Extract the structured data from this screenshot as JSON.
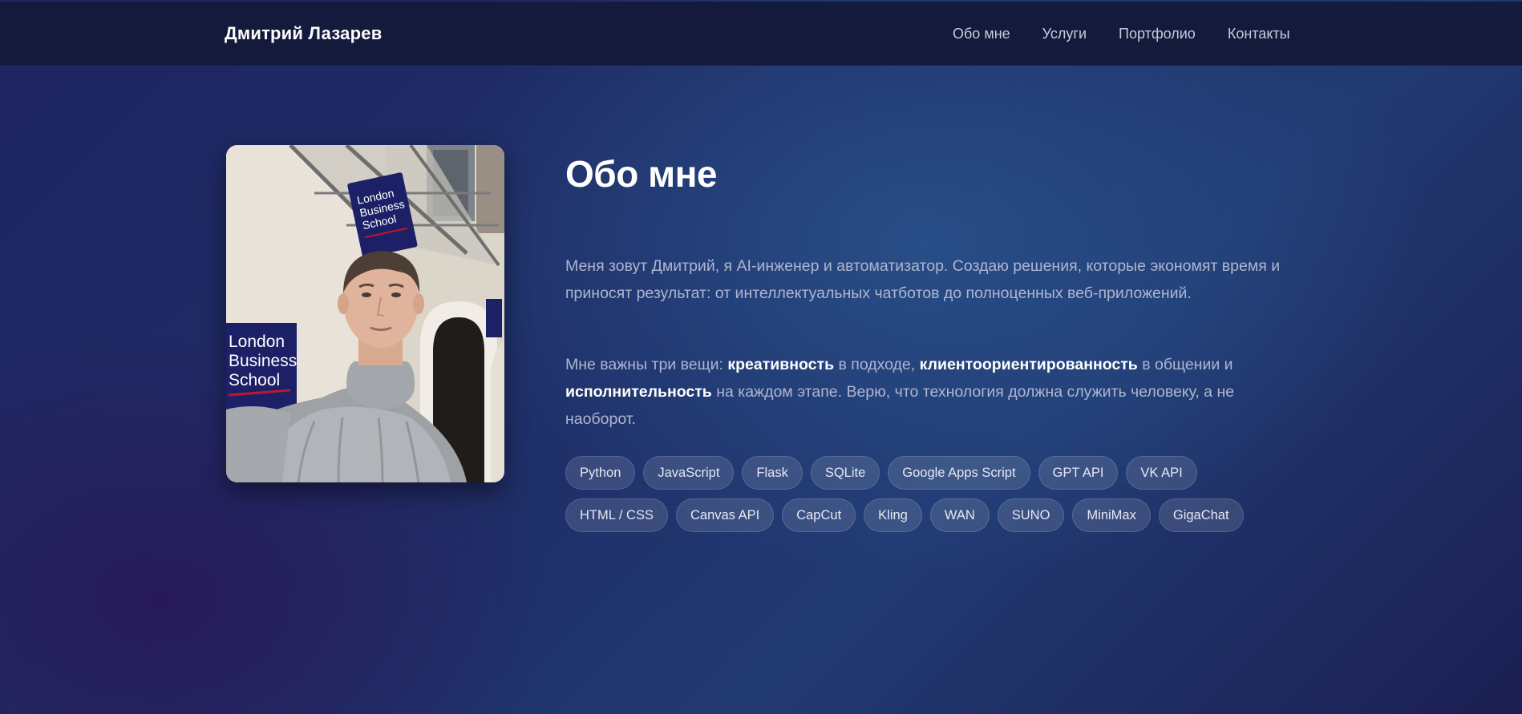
{
  "nav": {
    "brand": "Дмитрий Лазарев",
    "links": [
      "Обо мне",
      "Услуги",
      "Портфолио",
      "Контакты"
    ]
  },
  "photo": {
    "sign_1": [
      "London",
      "Business",
      "School"
    ],
    "sign_2": [
      "London",
      "Business",
      "School"
    ]
  },
  "about": {
    "title": "Обо мне",
    "paragraph1": "Меня зовут Дмитрий, я AI-инженер и автоматизатор. Создаю решения, которые экономят время и приносят результат: от интеллектуальных чатботов до полноценных веб-приложений.",
    "paragraph2": {
      "t1": "Мне важны три вещи: ",
      "b1": "креативность",
      "t2": " в подходе, ",
      "b2": "клиентоориентированность",
      "t3": " в общении и ",
      "b3": "исполнительность",
      "t4": " на каждом этапе. Верю, что технология должна служить человеку, а не наоборот."
    },
    "tags": [
      "Python",
      "JavaScript",
      "Flask",
      "SQLite",
      "Google Apps Script",
      "GPT API",
      "VK API",
      "HTML / CSS",
      "Canvas API",
      "CapCut",
      "Kling",
      "WAN",
      "SUNO",
      "MiniMax",
      "GigaChat"
    ]
  }
}
